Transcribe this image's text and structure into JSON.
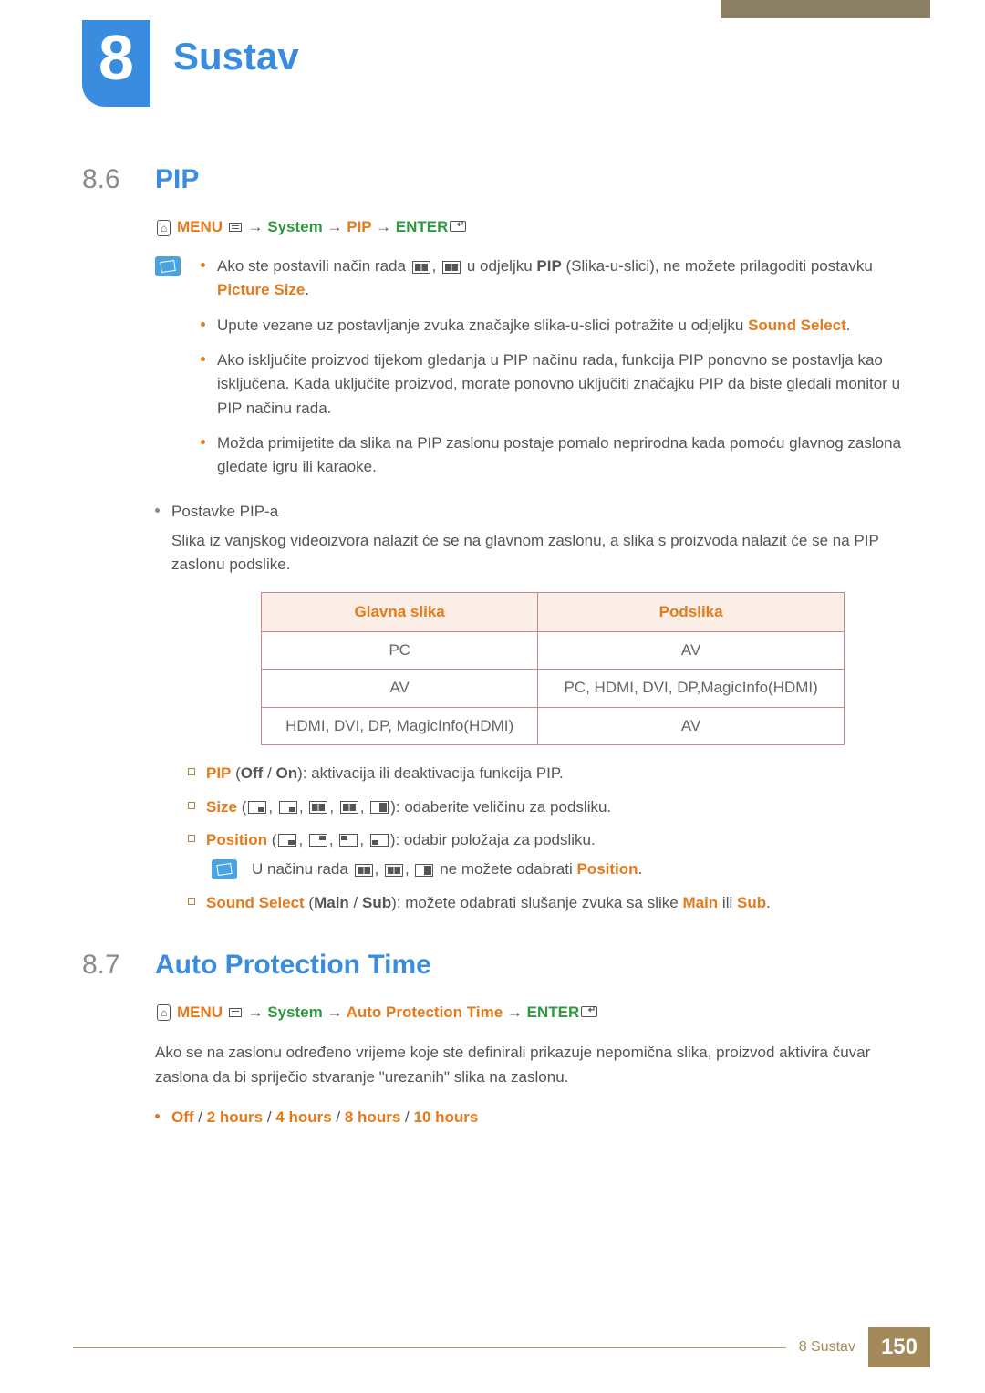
{
  "chapter": {
    "number": "8",
    "title": "Sustav"
  },
  "sections": {
    "s86": {
      "num": "8.6",
      "title": "PIP",
      "path": {
        "menu": "MENU",
        "p1": "System",
        "p2": "PIP",
        "enter": "ENTER",
        "arrow": "→"
      },
      "notes": {
        "n1a": "Ako ste postavili način rada ",
        "n1b": " u odjeljku ",
        "n1c": "PIP",
        "n1d": " (Slika-u-slici), ne možete prilagoditi postavku ",
        "n1e": "Picture Size",
        "n1f": ".",
        "n2a": "Upute vezane uz postavljanje zvuka značajke slika-u-slici potražite u odjeljku ",
        "n2b": "Sound Select",
        "n2c": ".",
        "n3": "Ako isključite proizvod tijekom gledanja u PIP načinu rada, funkcija PIP ponovno se postavlja kao isključena. Kada uključite proizvod, morate ponovno uključiti značajku PIP da biste gledali monitor u PIP načinu rada.",
        "n4": "Možda primijetite da slika na PIP zaslonu postaje pomalo neprirodna kada pomoću glavnog zaslona gledate igru ili karaoke."
      },
      "plain": {
        "p1": "Postavke PIP-a",
        "p2": "Slika iz vanjskog videoizvora nalazit će se na glavnom zaslonu, a slika s proizvoda nalazit će se na PIP zaslonu podslike."
      },
      "table": {
        "h1": "Glavna slika",
        "h2": "Podslika",
        "r1c1": "PC",
        "r1c2": "AV",
        "r2c1": "AV",
        "r2c2": "PC, HDMI, DVI, DP,MagicInfo(HDMI)",
        "r3c1": "HDMI, DVI, DP, MagicInfo(HDMI)",
        "r3c2": "AV"
      },
      "sq": {
        "l1a": "PIP",
        "l1b": " (",
        "l1c": "Off",
        "l1d": " / ",
        "l1e": "On",
        "l1f": "): aktivacija ili deaktivacija funkcija PIP.",
        "l2a": "Size",
        "l2b": " (",
        "l2c": "): odaberite veličinu za podsliku.",
        "l3a": "Position",
        "l3b": " (",
        "l3c": "): odabir položaja za podsliku.",
        "l4a": "U načinu rada ",
        "l4b": " ne možete odabrati ",
        "l4c": "Position",
        "l4d": ".",
        "l5a": "Sound Select",
        "l5b": " (",
        "l5c": "Main",
        "l5d": " / ",
        "l5e": "Sub",
        "l5f": "): možete odabrati slušanje zvuka sa slike ",
        "l5g": "Main",
        "l5h": " ili ",
        "l5i": "Sub",
        "l5j": "."
      }
    },
    "s87": {
      "num": "8.7",
      "title": "Auto Protection Time",
      "path": {
        "menu": "MENU",
        "p1": "System",
        "p2": "Auto Protection Time",
        "enter": "ENTER",
        "arrow": "→"
      },
      "body": "Ako se na zaslonu određeno vrijeme koje ste definirali prikazuje nepomična slika, proizvod aktivira čuvar zaslona da bi spriječio stvaranje \"urezanih\" slika na zaslonu.",
      "opts": {
        "a": "Off",
        "s": " / ",
        "b": "2 hours",
        "c": "4 hours",
        "d": "8 hours",
        "e": "10 hours"
      }
    }
  },
  "footer": {
    "crumb": "8 Sustav",
    "page": "150"
  }
}
